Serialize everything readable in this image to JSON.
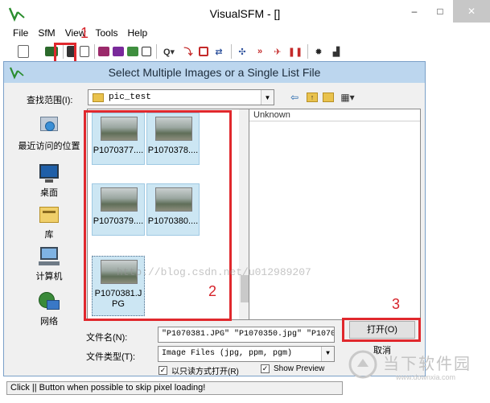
{
  "app": {
    "title": "VisualSFM - []",
    "controls": [
      "–",
      "□",
      "✕"
    ]
  },
  "menu": [
    "File",
    "SfM",
    "View",
    "Tools",
    "Help"
  ],
  "annotations": {
    "one": "1",
    "two": "2",
    "three": "3"
  },
  "toolbar": {
    "icons": [
      "open-nvm-icon",
      "open-images-icon",
      "save-icon",
      "copy-icon",
      "match-icon",
      "features-icon",
      "pairs-icon",
      "zoom-icon",
      "point-icon",
      "table-icon",
      "sift-icon",
      "compute-icon",
      "dense-icon",
      "pause-icon",
      "settings-icon",
      "log-icon"
    ]
  },
  "dialog": {
    "title": "Select Multiple Images or a Single List File",
    "look_in_label": "查找范围(I):",
    "look_in_value": "pic_test",
    "places": [
      {
        "label": "最近访问的位置",
        "icon": "recent-places-icon"
      },
      {
        "label": "桌面",
        "icon": "desktop-icon"
      },
      {
        "label": "库",
        "icon": "libraries-icon"
      },
      {
        "label": "计算机",
        "icon": "computer-icon"
      },
      {
        "label": "网络",
        "icon": "network-icon"
      }
    ],
    "files": [
      {
        "name": "P1070377...."
      },
      {
        "name": "P1070378...."
      },
      {
        "name": "P1070379...."
      },
      {
        "name": "P1070380...."
      },
      {
        "name": "P1070381.JPG"
      }
    ],
    "detail_header": "Unknown",
    "blog_watermark": "http://blog.csdn.net/u012989207",
    "filename_label": "文件名(N):",
    "filename_value": "\"P1070381.JPG\" \"P1070350.jpg\" \"P107035",
    "filetype_label": "文件类型(T):",
    "filetype_value": "Image Files (jpg, ppm, pgm)",
    "readonly_label": "以只读方式打开(R)",
    "readonly_checked": "✓",
    "preview_label": "Show Preview",
    "preview_checked": "✓",
    "open_button": "打开(O)",
    "cancel_button": "取消"
  },
  "status": "Click || Button when possible to skip pixel loading!",
  "brand": {
    "name": "当下软件园",
    "url": "www.downxia.com"
  },
  "colors": {
    "highlight_red": "#e0282d",
    "dialog_titlebar": "#bcd6ee",
    "thumb_selected": "#cce6f3"
  }
}
